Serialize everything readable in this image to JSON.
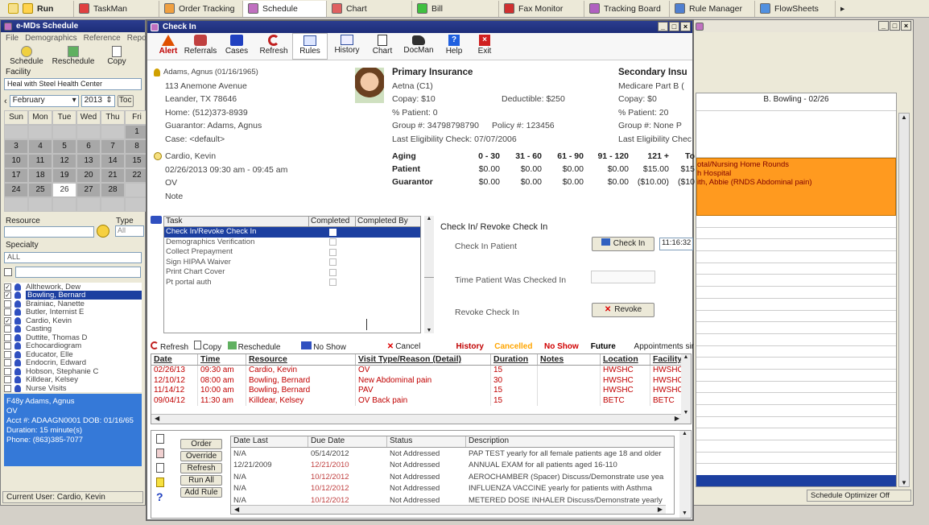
{
  "taskbar": [
    {
      "label": "Run",
      "color": "#e0b000"
    },
    {
      "label": "TaskMan",
      "color": "#c03030"
    },
    {
      "label": "Order Tracking",
      "color": "#d08020"
    },
    {
      "label": "Schedule",
      "color": "#a040a0"
    },
    {
      "label": "Chart",
      "color": "#c04040"
    },
    {
      "label": "Bill",
      "color": "#20a020"
    },
    {
      "label": "Fax Monitor",
      "color": "#c02020"
    },
    {
      "label": "Tracking Board",
      "color": "#a040a0"
    },
    {
      "label": "Rule Manager",
      "color": "#3060c0"
    },
    {
      "label": "FlowSheets",
      "color": "#3070c0"
    }
  ],
  "schedule": {
    "title": "e-MDs Schedule",
    "menu": [
      "File",
      "Demographics",
      "Reference",
      "Repo"
    ],
    "tools": [
      "Schedule",
      "Reschedule",
      "Copy"
    ],
    "facility_label": "Facility",
    "facility_value": "Heal with Steel Health Center",
    "month": "February",
    "year": "2013",
    "today": "Toc",
    "cal_head": [
      "Sun",
      "Mon",
      "Tue",
      "Wed",
      "Thu",
      "Fri"
    ],
    "cal_rows": [
      [
        "",
        "",
        "",
        "",
        "",
        "1"
      ],
      [
        "3",
        "4",
        "5",
        "6",
        "7",
        "8"
      ],
      [
        "10",
        "11",
        "12",
        "13",
        "14",
        "15"
      ],
      [
        "17",
        "18",
        "19",
        "20",
        "21",
        "22"
      ],
      [
        "24",
        "25",
        "26",
        "27",
        "28",
        ""
      ],
      [
        "",
        "",
        "",
        "",
        "",
        ""
      ]
    ],
    "resource_label": "Resource",
    "type_label": "Type",
    "type_value": "All",
    "specialty_label": "Specialty",
    "specialty_value": "ALL",
    "resources": [
      {
        "name": "Allthework, Dew",
        "checked": true
      },
      {
        "name": "Bowling, Bernard",
        "checked": true,
        "selected": true
      },
      {
        "name": "Brainiac, Nanette",
        "checked": false
      },
      {
        "name": "Butler, Internist E",
        "checked": false
      },
      {
        "name": "Cardio, Kevin",
        "checked": true
      },
      {
        "name": "Casting",
        "checked": false
      },
      {
        "name": "Duttite, Thomas D",
        "checked": false
      },
      {
        "name": "Echocardiogram",
        "checked": false
      },
      {
        "name": "Educator, Elle",
        "checked": false
      },
      {
        "name": "Endocrin, Edward",
        "checked": false
      },
      {
        "name": "Hobson, Stephanie C",
        "checked": false
      },
      {
        "name": "Killdear, Kelsey",
        "checked": false
      },
      {
        "name": "Nurse Visits",
        "checked": false
      }
    ],
    "info": [
      "F48y Adams, Agnus",
      "OV",
      "Acct #: ADAAGN0001 DOB: 01/16/65",
      "Duration: 15 minute(s)",
      "Phone: (863)385-7077"
    ],
    "status": "Current User: Cardio, Kevin"
  },
  "right": {
    "header": "B. Bowling - 02/26",
    "appt": [
      "otal/Nursing Home Rounds",
      "h Hospital",
      "ith, Abbie (RNDS  Abdominal pain)"
    ],
    "status": "Schedule Optimizer Off"
  },
  "checkin": {
    "title": "Check In",
    "toolbar": [
      "Alert",
      "Referrals",
      "Cases",
      "Refresh",
      "Rules",
      "History",
      "Chart",
      "DocMan",
      "Help",
      "Exit"
    ],
    "patient": {
      "name": "Adams, Agnus (01/16/1965)",
      "addr1": "113 Anemone Avenue",
      "addr2": "Leander, TX 78646",
      "home": "Home: (512)373-8939",
      "guarantor": "Guarantor: Adams, Agnus",
      "case": "Case: <default>"
    },
    "appt": {
      "provider": "Cardio, Kevin",
      "time": "02/26/2013  09:30 am - 09:45 am",
      "type": "OV",
      "note": "Note"
    },
    "primary": {
      "heading": "Primary Insurance",
      "plan": "Aetna (C1)",
      "copay": "Copay: $10",
      "deductible": "Deductible: $250",
      "pct": "% Patient: 0",
      "group": "Group #: 34798798790",
      "policy": "Policy #: 123456",
      "elig": "Last Eligibility Check: 07/07/2006"
    },
    "secondary": {
      "heading": "Secondary Insu",
      "plan": "Medicare Part B (",
      "copay": "Copay: $0",
      "pct": "% Patient: 20",
      "group": "Group #: None",
      "group2": "P",
      "elig": "Last Eligibility Chec"
    },
    "aging": {
      "heads": [
        "Aging",
        "0 - 30",
        "31 - 60",
        "61 - 90",
        "91 - 120",
        "121 +",
        "To"
      ],
      "patient": [
        "Patient",
        "$0.00",
        "$0.00",
        "$0.00",
        "$0.00",
        "$15.00",
        "$15"
      ],
      "guarantor": [
        "Guarantor",
        "$0.00",
        "$0.00",
        "$0.00",
        "$0.00",
        "($10.00)",
        "($10"
      ]
    },
    "tasks": {
      "cols": [
        "Task",
        "Completed",
        "Completed By"
      ],
      "rows": [
        "Check In/Revoke Check In",
        "Demographics Verification",
        "Collect Prepayment",
        "Sign HIPAA Waiver",
        "Print Chart Cover",
        "Pt portal auth"
      ]
    },
    "panel": {
      "title": "Check In/ Revoke Check In",
      "checkin_label": "Check In Patient",
      "checkin_btn": "Check In",
      "time_value": "11:16:32",
      "checked_label": "Time Patient Was Checked In",
      "revoke_label": "Revoke Check In",
      "revoke_btn": "Revoke"
    },
    "appt_toolbar": {
      "refresh": "Refresh",
      "copy": "Copy",
      "reschedule": "Reschedule",
      "noshow": "No Show",
      "cancel": "Cancel",
      "history": "History",
      "cancelled": "Cancelled",
      "noshow2": "No Show",
      "future": "Future",
      "appts": "Appointments sir"
    },
    "appt_cols": [
      "Date",
      "Time",
      "Resource",
      "Visit Type/Reason (Detail)",
      "Duration",
      "Notes",
      "Location",
      "Facility"
    ],
    "appt_rows": [
      [
        "02/26/13",
        "09:30 am",
        "Cardio, Kevin",
        "OV",
        "15",
        "",
        "HWSHC",
        "HWSHC"
      ],
      [
        "12/10/12",
        "08:00 am",
        "Bowling, Bernard",
        "New   Abdominal pain",
        "30",
        "",
        "HWSHC",
        "HWSHC"
      ],
      [
        "11/14/12",
        "10:00 am",
        "Bowling, Bernard",
        "PAV",
        "15",
        "",
        "HWSHC",
        "HWSHC"
      ],
      [
        "09/04/12",
        "11:30 am",
        "Killdear, Kelsey",
        "OV  Back pain",
        "15",
        "",
        "BETC",
        "BETC"
      ]
    ],
    "rule_btns": [
      "Order",
      "Override",
      "Refresh",
      "Run All",
      "Add Rule"
    ],
    "rule_cols": [
      "Date Last",
      "Due Date",
      "Status",
      "Description"
    ],
    "rule_rows": [
      [
        "N/A",
        "05/14/2012",
        "Not Addressed",
        "PAP TEST yearly for all female patients age 18 and older"
      ],
      [
        "12/21/2009",
        "12/21/2010",
        "Not Addressed",
        "ANNUAL EXAM for all patients aged 16-110"
      ],
      [
        "N/A",
        "10/12/2012",
        "Not Addressed",
        "AEROCHAMBER (Spacer) Discuss/Demonstrate use yea"
      ],
      [
        "N/A",
        "10/12/2012",
        "Not Addressed",
        "INFLUENZA VACCINE yearly for patients with Asthma"
      ],
      [
        "N/A",
        "10/12/2012",
        "Not Addressed",
        "METERED DOSE INHALER Discuss/Demonstrate yearly"
      ]
    ]
  },
  "colors": {
    "title": "#1d2d78",
    "select": "#1c3fa0",
    "orange": "#ff9a1f",
    "red": "#cc0000",
    "apptred": "#c00000"
  }
}
